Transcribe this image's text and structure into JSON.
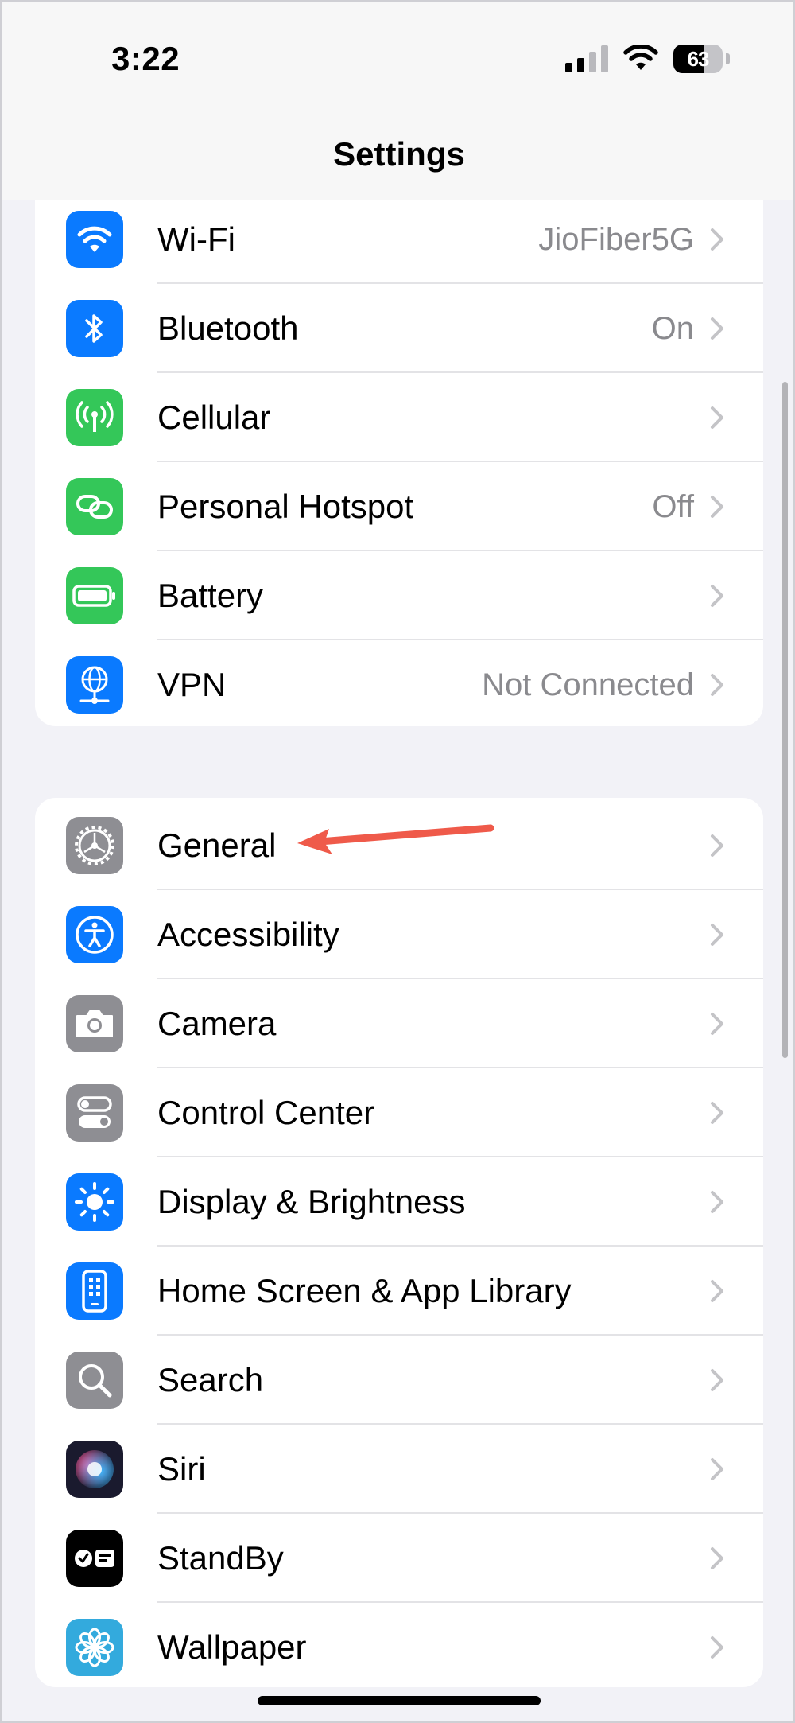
{
  "status": {
    "time": "3:22",
    "battery": "63",
    "battery_level": 0.63
  },
  "nav": {
    "title": "Settings"
  },
  "connectivity": [
    {
      "label": "Wi-Fi",
      "value": "JioFiber5G",
      "icon": "wifi-icon",
      "color": "#0a7aff"
    },
    {
      "label": "Bluetooth",
      "value": "On",
      "icon": "bluetooth-icon",
      "color": "#0a7aff"
    },
    {
      "label": "Cellular",
      "value": "",
      "icon": "cellular-antenna-icon",
      "color": "#34c759"
    },
    {
      "label": "Personal Hotspot",
      "value": "Off",
      "icon": "hotspot-link-icon",
      "color": "#34c759"
    },
    {
      "label": "Battery",
      "value": "",
      "icon": "battery-icon",
      "color": "#34c759"
    },
    {
      "label": "VPN",
      "value": "Not Connected",
      "icon": "vpn-globe-icon",
      "color": "#0a7aff"
    }
  ],
  "system": [
    {
      "label": "General",
      "icon": "gear-icon",
      "color": "#8e8e93"
    },
    {
      "label": "Accessibility",
      "icon": "accessibility-icon",
      "color": "#0a7aff"
    },
    {
      "label": "Camera",
      "icon": "camera-icon",
      "color": "#8e8e93"
    },
    {
      "label": "Control Center",
      "icon": "toggles-icon",
      "color": "#8e8e93"
    },
    {
      "label": "Display & Brightness",
      "icon": "sun-icon",
      "color": "#0a7aff"
    },
    {
      "label": "Home Screen & App Library",
      "icon": "phone-grid-icon",
      "color": "#0a7aff"
    },
    {
      "label": "Search",
      "icon": "magnifier-icon",
      "color": "#8e8e93"
    },
    {
      "label": "Siri",
      "icon": "siri-icon",
      "color": "#1a1a2e"
    },
    {
      "label": "StandBy",
      "icon": "standby-icon",
      "color": "#000000"
    },
    {
      "label": "Wallpaper",
      "icon": "flower-icon",
      "color": "#33aadd"
    }
  ],
  "annotation": {
    "arrow_color": "#ef5a4a"
  }
}
